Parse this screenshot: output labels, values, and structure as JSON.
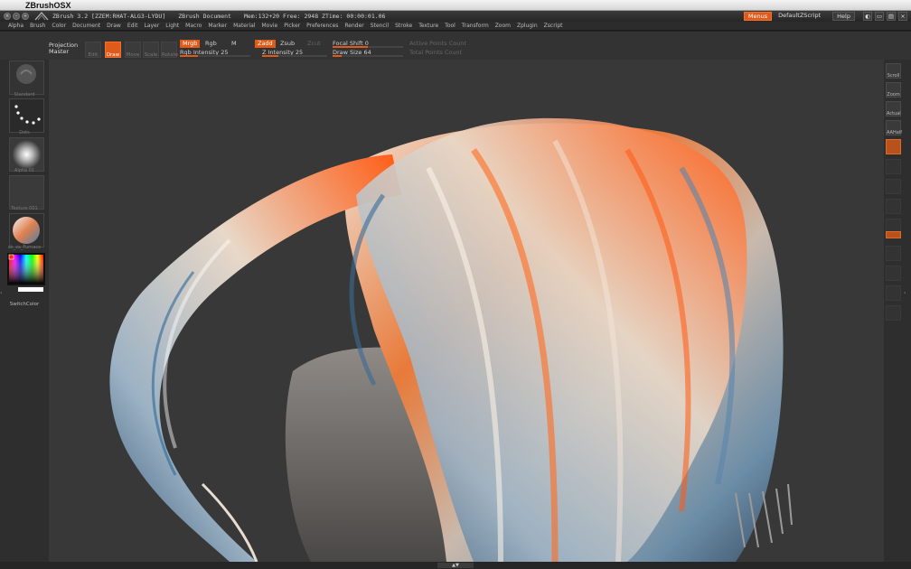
{
  "system_menubar": {
    "app_name": "ZBrushOSX"
  },
  "titlebar": {
    "title": "ZBrush 3.2 [ZZEM:RHAT-ALG3-LYDU]",
    "document": "ZBrush Document",
    "stats": "Mem:132+20  Free: 2948  ZTime: 00:00:01.06",
    "menus_btn": "Menus",
    "script_btn": "DefaultZScript",
    "help_btn": "Help"
  },
  "menubar": [
    "Alpha",
    "Brush",
    "Color",
    "Document",
    "Draw",
    "Edit",
    "Layer",
    "Light",
    "Macro",
    "Marker",
    "Material",
    "Movie",
    "Picker",
    "Preferences",
    "Render",
    "Stencil",
    "Stroke",
    "Texture",
    "Tool",
    "Transform",
    "Zoom",
    "Zplugin",
    "Zscript"
  ],
  "shelf": {
    "projection_master": "Projection\nMaster",
    "edit_label": "Edit",
    "draw_label": "Draw",
    "move_label": "Move",
    "scale_label": "Scale",
    "rotate_label": "Rotate",
    "mrgb": "Mrgb",
    "rgb": "Rgb",
    "m": "M",
    "zadd": "Zadd",
    "zsub": "Zsub",
    "zcut": "Zcut",
    "rgb_intensity": "Rgb Intensity 25",
    "rgb_intensity_value": 25,
    "z_intensity": "Z Intensity 25",
    "z_intensity_value": 25,
    "focal_shift": "Focal Shift 0",
    "focal_shift_value": 0,
    "draw_size": "Draw Size 64",
    "draw_size_value": 64,
    "active_points": "Active Points Count",
    "total_points": "Total Points Count"
  },
  "left_tray": {
    "brush": "Standard",
    "stroke": "Dots",
    "alpha": "Alpha 01",
    "texture": "Texture 001",
    "material": "ak_za_Furnace",
    "switch_color": "SwitchColor"
  },
  "right_tray": {
    "scroll": "Scroll",
    "zoom": "Zoom",
    "actual": "Actual",
    "aahalf": "AAHalf"
  },
  "colors": {
    "accent": "#e05a1a",
    "ui_bg": "#2e2e2e",
    "canvas_bg": "#383838"
  }
}
